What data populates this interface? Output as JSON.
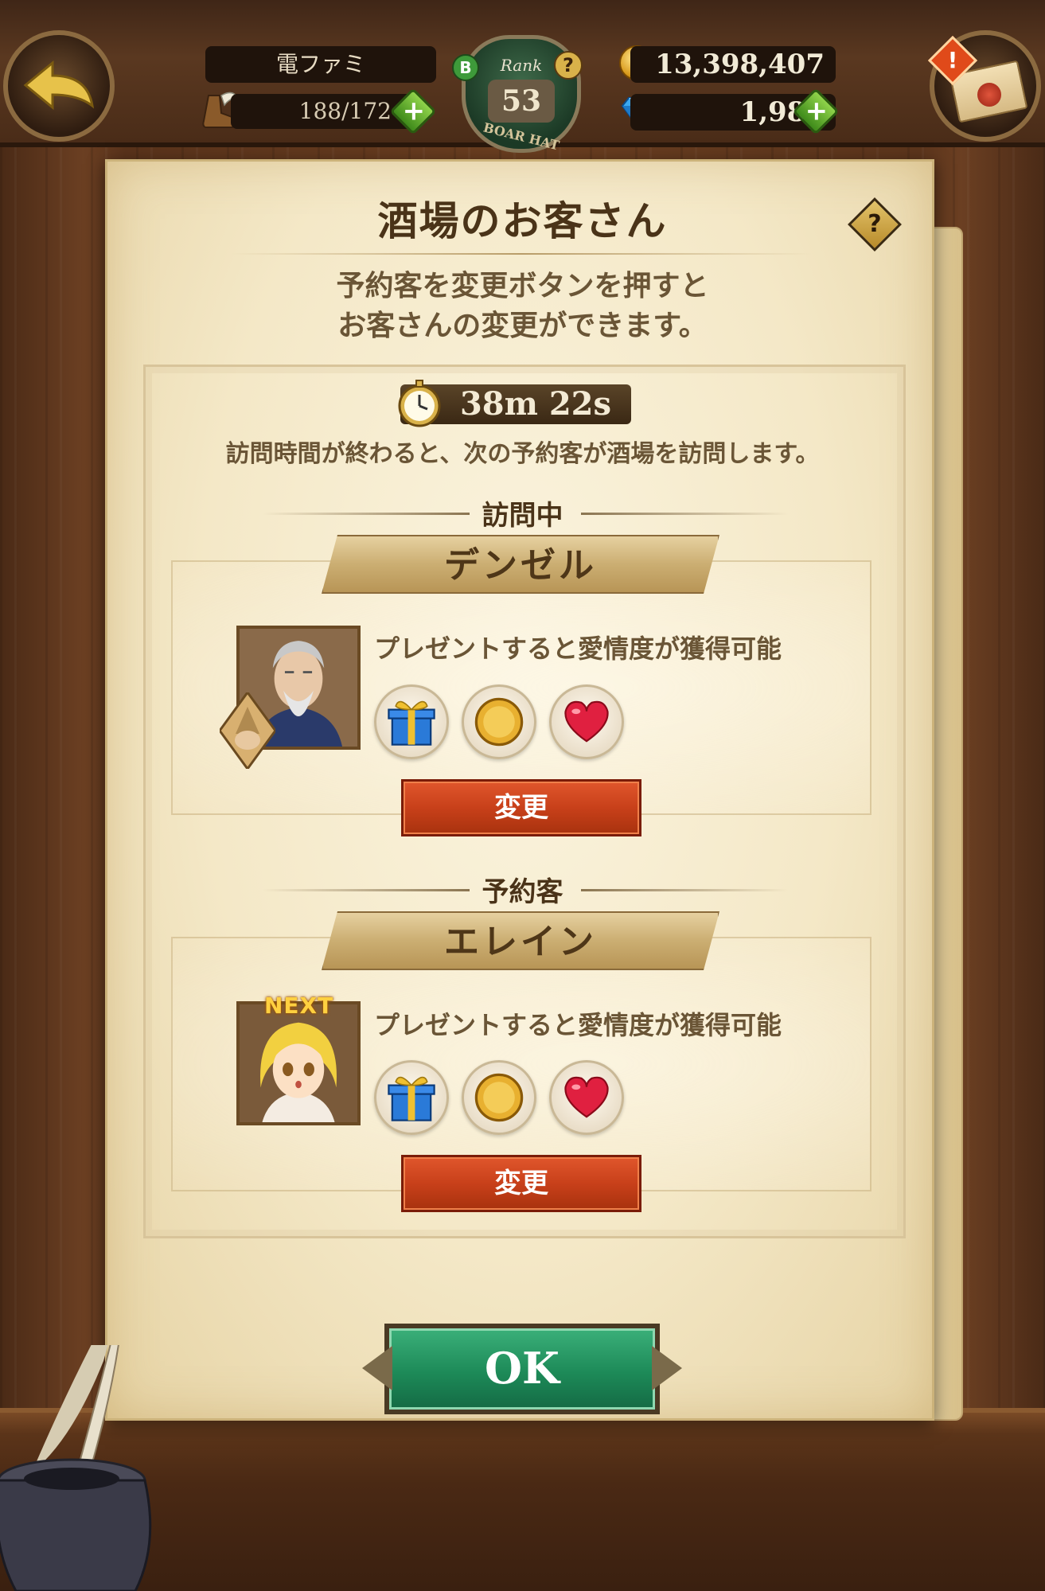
{
  "header": {
    "player_name": "電ファミ",
    "stamina": "188/172",
    "rank_label": "Rank",
    "rank_number": "53",
    "rank_title": "BOAR HAT",
    "rank_grade": "B",
    "gold": "13,398,407",
    "gems": "1,981",
    "help_glyph": "?",
    "alert_glyph": "!",
    "plus_glyph": "+"
  },
  "dialog": {
    "title": "酒場のお客さん",
    "help_glyph": "?",
    "description_line1": "予約客を変更ボタンを押すと",
    "description_line2": "お客さんの変更ができます。",
    "timer": "38m 22s",
    "timer_note": "訪問時間が終わると、次の予約客が酒場を訪問します。",
    "ok_label": "OK"
  },
  "visiting": {
    "section_label": "訪問中",
    "name": "デンゼル",
    "perk_text": "プレゼントすると愛情度が獲得可能",
    "perks": [
      "gift-icon",
      "coin-icon",
      "heart-icon"
    ],
    "change_label": "変更"
  },
  "reserved": {
    "section_label": "予約客",
    "name": "エレイン",
    "next_tag": "NEXT",
    "perk_text": "プレゼントすると愛情度が獲得可能",
    "perks": [
      "gift-icon",
      "coin-icon",
      "heart-icon"
    ],
    "change_label": "変更"
  },
  "colors": {
    "parchment": "#f4e8c7",
    "change_button": "#c8401a",
    "ok_button": "#1d8a58",
    "wood": "#5a331b"
  }
}
